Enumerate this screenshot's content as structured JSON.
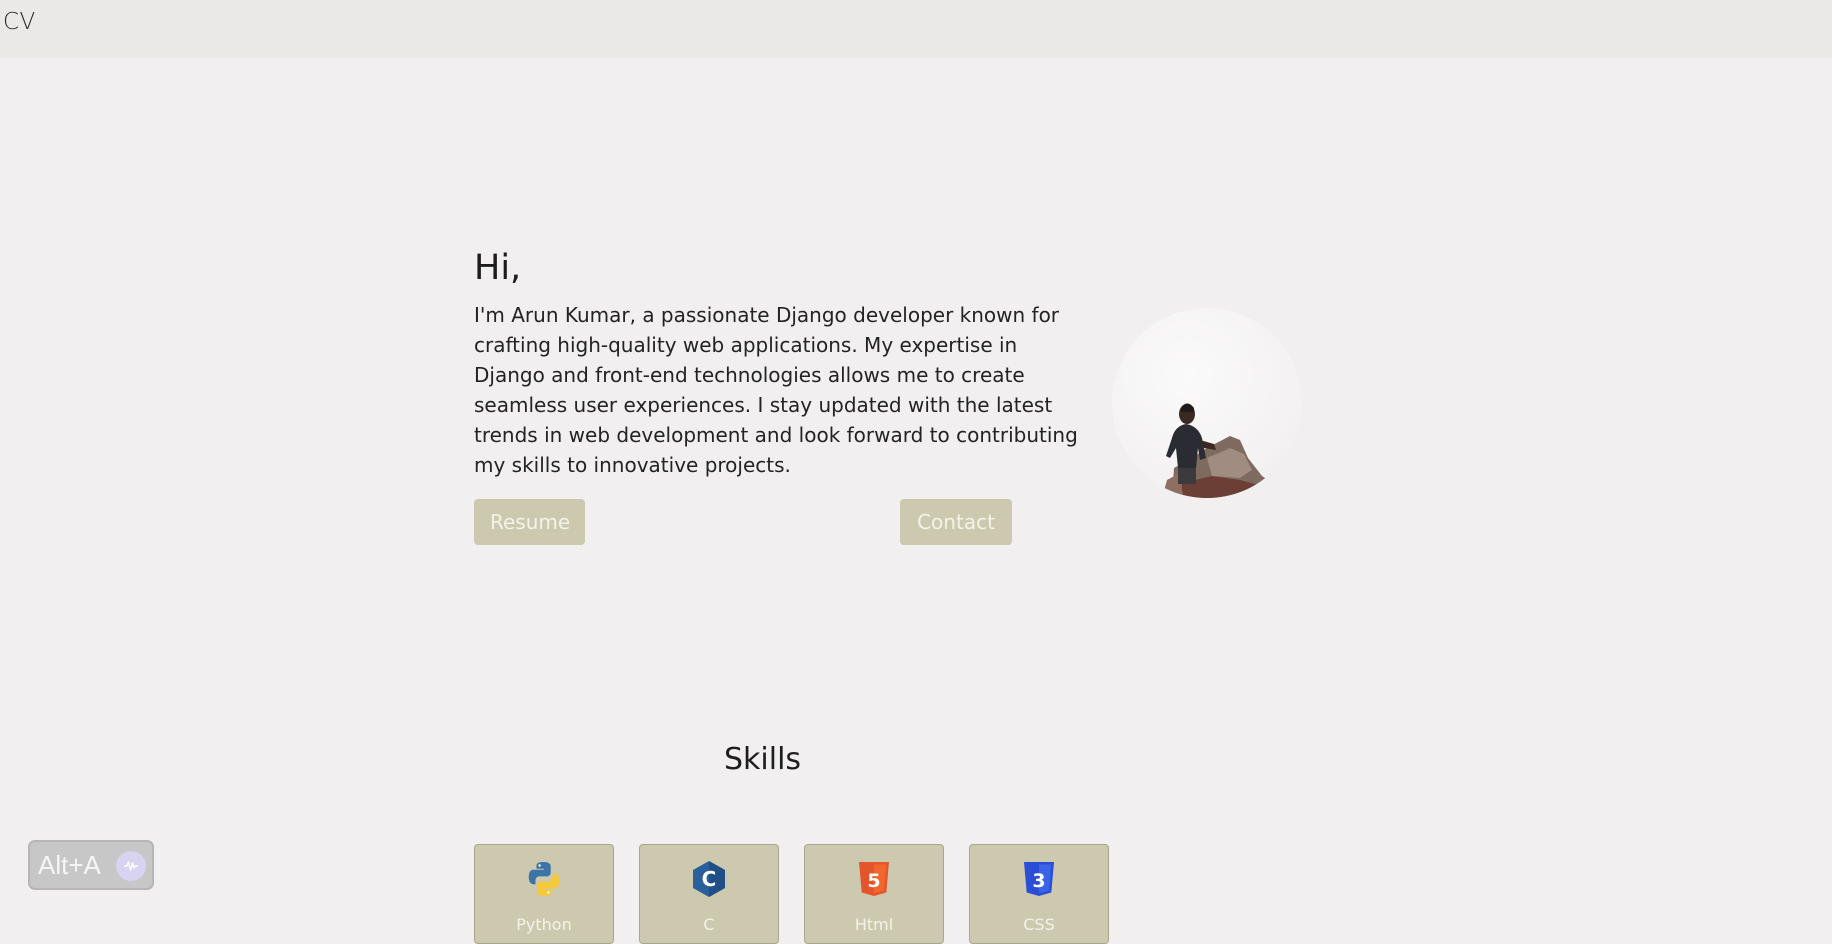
{
  "nav": {
    "brand": "CV"
  },
  "hero": {
    "greeting": "Hi,",
    "bio": "I'm Arun Kumar, a passionate Django developer known for crafting high-quality web applications. My expertise in Django and front-end technologies allows me to create seamless user experiences. I stay updated with the latest trends in web development and look forward to contributing my skills to innovative projects.",
    "resume_label": "Resume",
    "contact_label": "Contact",
    "avatar_icon": "profile-photo"
  },
  "skills": {
    "title": "Skills",
    "items": [
      {
        "label": "Python",
        "icon": "python-logo-icon"
      },
      {
        "label": "C",
        "icon": "c-logo-icon"
      },
      {
        "label": "Html",
        "icon": "html5-logo-icon"
      },
      {
        "label": "CSS",
        "icon": "css3-logo-icon"
      }
    ]
  },
  "overlay": {
    "shortcut": "Alt+A",
    "icon": "voice-wave-icon"
  },
  "colors": {
    "background": "#f1eff0",
    "navbar": "#ebe9e7",
    "accent": "#ccc9ae",
    "button_text": "#f4f3ea"
  }
}
